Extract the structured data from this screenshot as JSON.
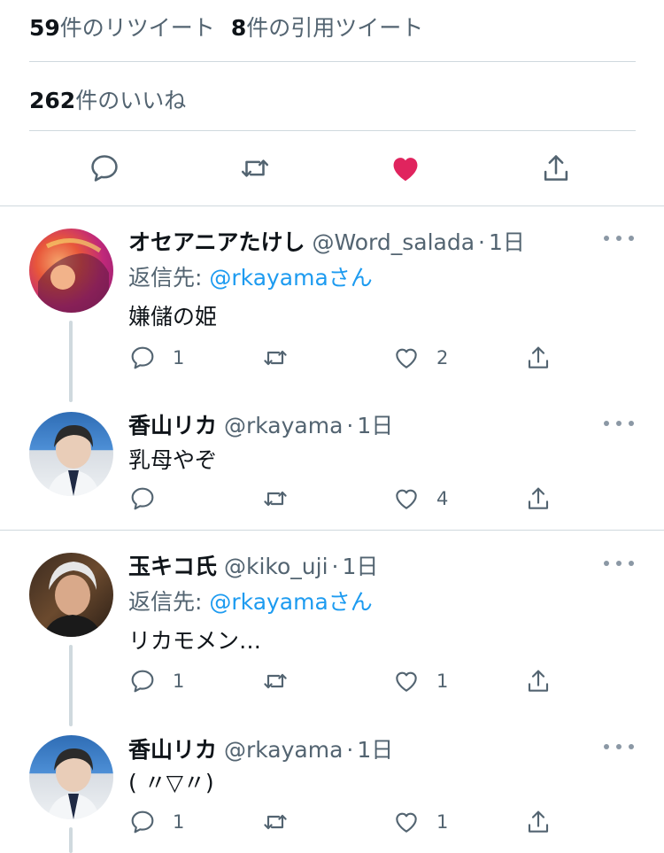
{
  "stats": {
    "retweet_count": "59",
    "retweet_label": "件のリツイート",
    "quote_count": "8",
    "quote_label": "件の引用ツイート",
    "like_count": "262",
    "like_label": "件のいいね"
  },
  "colors": {
    "like_red": "#f91880",
    "mention_blue": "#1d9bf0",
    "secondary_text": "#536471",
    "divider": "#cfd9de"
  },
  "replies": [
    {
      "name": "オセアニアたけし",
      "handle": "@Word_salada",
      "time": "1日",
      "reply_prefix": "返信先: ",
      "reply_mention": "@rkayamaさん",
      "text": "嫌儲の姫",
      "reply_count": "1",
      "like_count": "2"
    },
    {
      "name": "香山リカ",
      "handle": "@rkayama",
      "time": "1日",
      "text": "乳母やぞ",
      "reply_count": "",
      "like_count": "4"
    },
    {
      "name": "玉キコ氏",
      "handle": "@kiko_uji",
      "time": "1日",
      "reply_prefix": "返信先: ",
      "reply_mention": "@rkayamaさん",
      "text": "リカモメン…",
      "reply_count": "1",
      "like_count": "1"
    },
    {
      "name": "香山リカ",
      "handle": "@rkayama",
      "time": "1日",
      "text": "( 〃▽〃)",
      "reply_count": "1",
      "like_count": "1"
    }
  ]
}
